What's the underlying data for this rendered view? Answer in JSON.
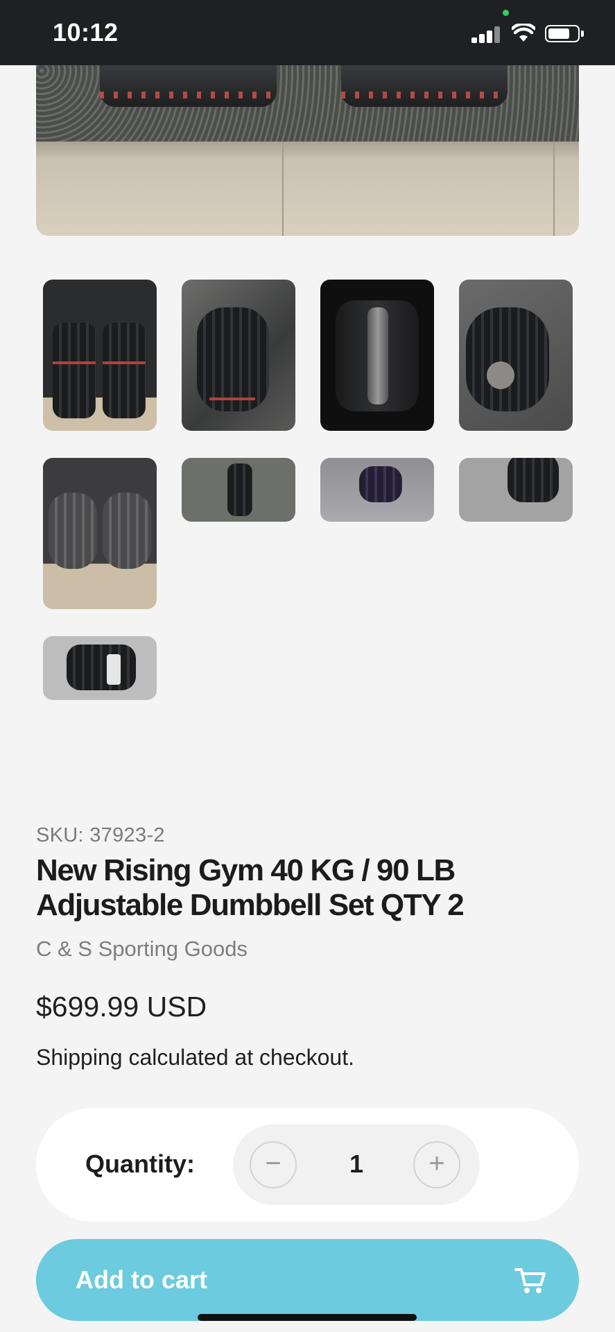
{
  "status_bar": {
    "time": "10:12",
    "icons": [
      "signal-icon",
      "wifi-icon",
      "battery-icon"
    ]
  },
  "gallery": {
    "main_image": "adjustable-dumbbells-photo",
    "thumbnails": [
      {
        "name": "thumbnail-1"
      },
      {
        "name": "thumbnail-2"
      },
      {
        "name": "thumbnail-3"
      },
      {
        "name": "thumbnail-4"
      },
      {
        "name": "thumbnail-5"
      },
      {
        "name": "thumbnail-6"
      },
      {
        "name": "thumbnail-7"
      },
      {
        "name": "thumbnail-8"
      },
      {
        "name": "thumbnail-9"
      }
    ]
  },
  "product": {
    "sku": "SKU: 37923-2",
    "title": "New Rising Gym 40 KG / 90 LB Adjustable Dumbbell Set QTY 2",
    "vendor": "C & S Sporting Goods",
    "price": "$699.99 USD",
    "shipping_link": "Shipping",
    "shipping_text": " calculated at checkout."
  },
  "quantity": {
    "label": "Quantity:",
    "value": "1",
    "minus": "−",
    "plus": "+"
  },
  "cart": {
    "label": "Add to cart",
    "icon": "cart-icon"
  },
  "colors": {
    "accent": "#6ccbde",
    "background": "#f4f4f4",
    "status_bar": "#1f2024"
  }
}
